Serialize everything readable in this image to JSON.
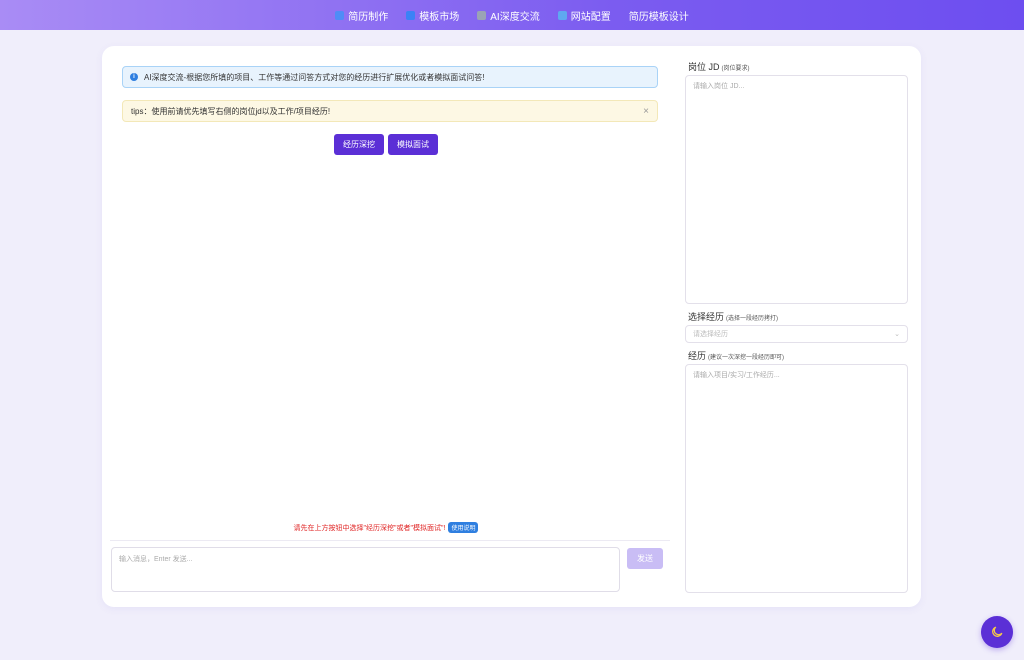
{
  "nav": {
    "items": [
      {
        "label": "简历制作",
        "icon": "edit-icon",
        "color": "#4f8cf7"
      },
      {
        "label": "模板市场",
        "icon": "grid-icon",
        "color": "#3b82f6"
      },
      {
        "label": "AI深度交流",
        "icon": "robot-icon",
        "color": "#9aa3b5"
      },
      {
        "label": "网站配置",
        "icon": "document-icon",
        "color": "#5fa8f0"
      },
      {
        "label": "简历模板设计",
        "icon": "",
        "color": ""
      }
    ]
  },
  "chat": {
    "info_text": "AI深度交流-根据您所填的项目、工作等通过问答方式对您的经历进行扩展优化或者模拟面试问答!",
    "tip_text": "tips：使用前请优先填写右侧的岗位jd以及工作/项目经历!",
    "close_symbol": "×",
    "mode_buttons": [
      "经历深挖",
      "模拟面试"
    ],
    "hint_text": "请先在上方按钮中选择\"经历深挖\"或者\"模拟面试\"!",
    "help_label": "使用说明",
    "input_placeholder": "输入消息，Enter 发送...",
    "send_label": "发送"
  },
  "form": {
    "jd_label": "岗位 JD",
    "jd_sub": "(岗位要求)",
    "jd_placeholder": "请输入岗位 JD...",
    "select_label": "选择经历",
    "select_sub": "(选择一段经历拷打)",
    "select_placeholder": "请选择经历",
    "exp_label": "经历",
    "exp_sub": "(建议一次深挖一段经历即可)",
    "exp_placeholder": "请输入项目/实习/工作经历..."
  },
  "colors": {
    "accent": "#5b2fd6",
    "error": "#e02424",
    "info": "#2f7fe0"
  }
}
